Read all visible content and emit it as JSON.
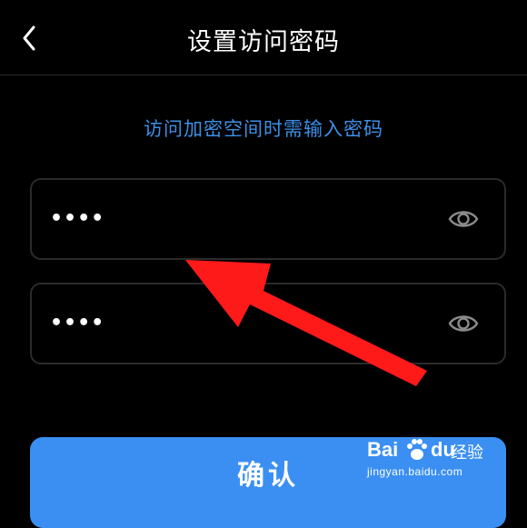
{
  "header": {
    "title": "设置访问密码",
    "back_icon": "chevron-left-icon"
  },
  "hint": "访问加密空间时需输入密码",
  "fields": [
    {
      "value": "••••",
      "eye_icon": "eye-icon"
    },
    {
      "value": "••••",
      "eye_icon": "eye-icon"
    }
  ],
  "confirm": {
    "label": "确认"
  },
  "watermark": {
    "logo_prefix": "Bai",
    "logo_suffix": "du",
    "product": "经验",
    "url": "jingyan.baidu.com"
  },
  "colors": {
    "accent": "#3d8fe6",
    "button": "#3b8ff2",
    "background": "#000000",
    "field_border": "#2b2b2b",
    "annotation_arrow": "#ff1a1a"
  }
}
